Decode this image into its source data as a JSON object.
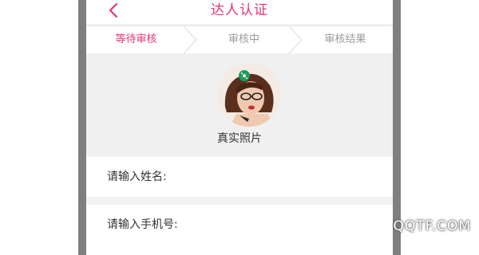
{
  "header": {
    "title": "达人认证",
    "back_icon": "chevron-left-icon"
  },
  "steps": [
    {
      "label": "等待审核",
      "state": "active"
    },
    {
      "label": "审核中",
      "state": "inactive"
    },
    {
      "label": "审核结果",
      "state": "inactive"
    }
  ],
  "avatar": {
    "caption": "真实照片"
  },
  "form": {
    "name_label": "请输入姓名:",
    "phone_label": "请输入手机号:"
  },
  "colors": {
    "accent": "#e9347a",
    "muted": "#9a9a9a",
    "background": "#f2f2f2"
  },
  "watermark": "QQTF.COM"
}
